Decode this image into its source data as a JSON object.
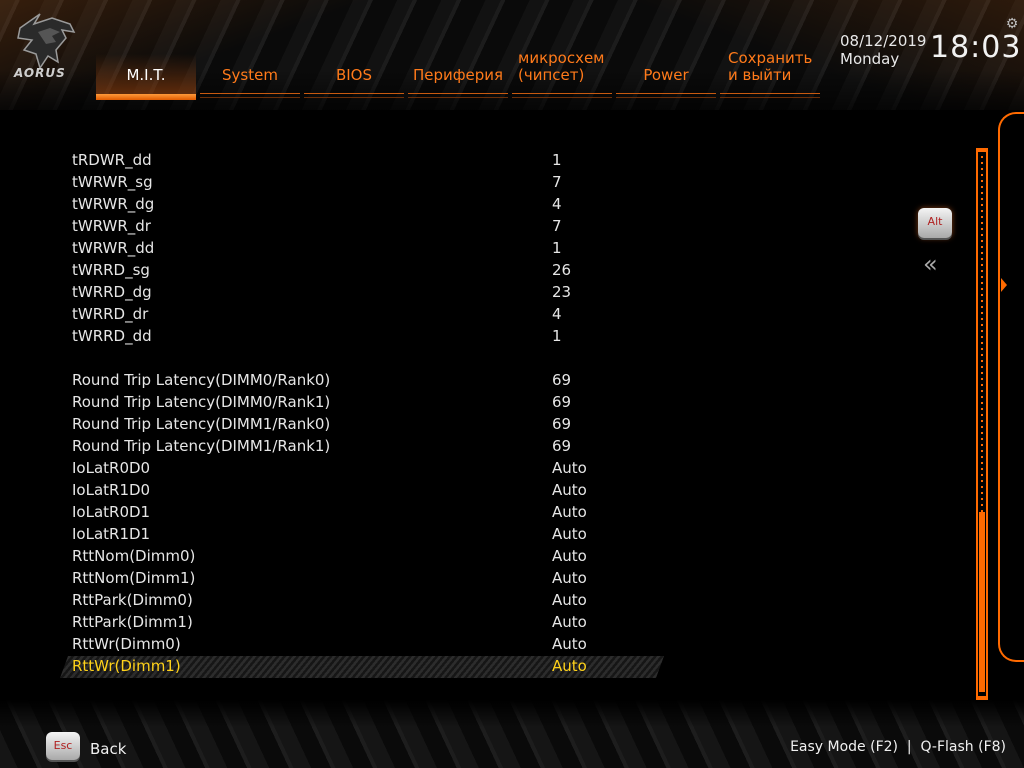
{
  "brand": {
    "logo_text": "AORUS"
  },
  "tabs": [
    {
      "label": "M.I.T.",
      "active": true
    },
    {
      "label": "System"
    },
    {
      "label": "BIOS"
    },
    {
      "label": "Периферия"
    },
    {
      "label_line1": "микросхем",
      "label_line2": "(чипсет)"
    },
    {
      "label": "Power"
    },
    {
      "label_line1": "Сохранить",
      "label_line2": "и выйти"
    }
  ],
  "datetime": {
    "date": "08/12/2019",
    "day": "Monday",
    "time": "18:03"
  },
  "settings": [
    {
      "name": "tRDWR_dd",
      "value": "1"
    },
    {
      "name": "tWRWR_sg",
      "value": "7"
    },
    {
      "name": "tWRWR_dg",
      "value": "4"
    },
    {
      "name": "tWRWR_dr",
      "value": "7"
    },
    {
      "name": "tWRWR_dd",
      "value": "1"
    },
    {
      "name": "tWRRD_sg",
      "value": "26"
    },
    {
      "name": "tWRRD_dg",
      "value": "23"
    },
    {
      "name": "tWRRD_dr",
      "value": "4"
    },
    {
      "name": "tWRRD_dd",
      "value": "1"
    },
    {
      "name": "Round Trip Latency(DIMM0/Rank0)",
      "value": "69"
    },
    {
      "name": "Round Trip Latency(DIMM0/Rank1)",
      "value": "69"
    },
    {
      "name": "Round Trip Latency(DIMM1/Rank0)",
      "value": "69"
    },
    {
      "name": "Round Trip Latency(DIMM1/Rank1)",
      "value": "69"
    },
    {
      "name": "IoLatR0D0",
      "value": "Auto"
    },
    {
      "name": "IoLatR1D0",
      "value": "Auto"
    },
    {
      "name": "IoLatR0D1",
      "value": "Auto"
    },
    {
      "name": "IoLatR1D1",
      "value": "Auto"
    },
    {
      "name": "RttNom(Dimm0)",
      "value": "Auto"
    },
    {
      "name": "RttNom(Dimm1)",
      "value": "Auto"
    },
    {
      "name": "RttPark(Dimm0)",
      "value": "Auto"
    },
    {
      "name": "RttPark(Dimm1)",
      "value": "Auto"
    },
    {
      "name": "RttWr(Dimm0)",
      "value": "Auto"
    },
    {
      "name": "RttWr(Dimm1)",
      "value": "Auto"
    }
  ],
  "side": {
    "alt_key": "Alt",
    "collapse_icon": "double-chevron-left-icon"
  },
  "footer": {
    "esc_key": "Esc",
    "back_label": "Back",
    "shortcuts": "Easy Mode (F2)  |  Q-Flash (F8)"
  },
  "colors": {
    "accent": "#ff6a00",
    "selected_text": "#ffd21a",
    "text": "#e6e6e6"
  }
}
